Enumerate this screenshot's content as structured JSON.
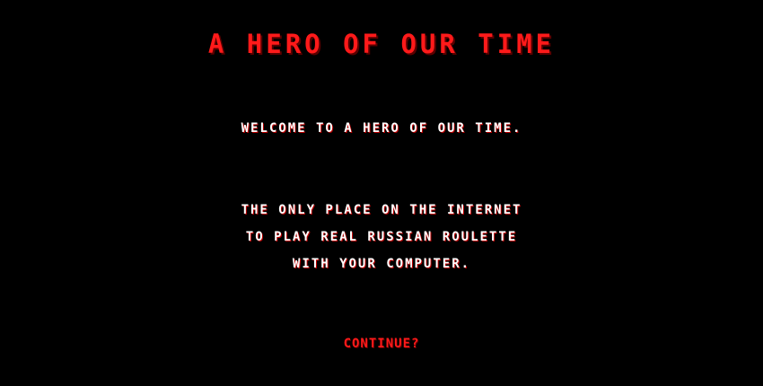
{
  "game": {
    "title": "A HERO OF OUR TIME",
    "welcome": "WELCOME TO A HERO OF OUR TIME.",
    "description_lines": [
      "THE ONLY PLACE ON THE INTERNET",
      "TO PLAY REAL RUSSIAN ROULETTE",
      "WITH YOUR COMPUTER."
    ],
    "continue_label": "CONTINUE?"
  },
  "colors": {
    "background": "#000000",
    "title_red": "#ff1a1a",
    "text_white": "#ffffff",
    "shadow_red": "#c00000"
  }
}
